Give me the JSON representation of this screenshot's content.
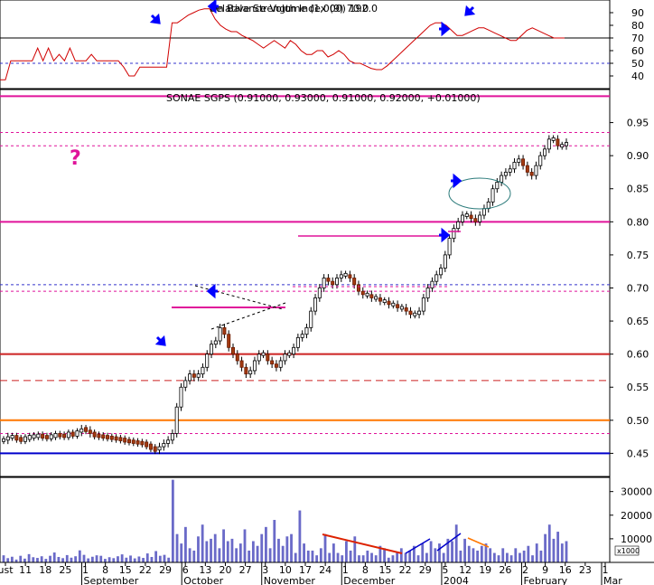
{
  "chart_data": [
    {
      "type": "line",
      "title": "Relative Strength Index (9) 70.0",
      "overlapping_label": "On Balance Volume (1,000) 192.0",
      "ylim": [
        30,
        100
      ],
      "yticks": [
        40,
        50,
        60,
        70,
        80,
        90
      ],
      "reference_lines": [
        70,
        50
      ],
      "series": [
        {
          "values": [
            37,
            37,
            52,
            52,
            52,
            52,
            52,
            62,
            52,
            62,
            52,
            57,
            52,
            62,
            52,
            52,
            52,
            57,
            52,
            52,
            52,
            52,
            52,
            47,
            40,
            40,
            47,
            47,
            47,
            47,
            47,
            47,
            82,
            82,
            85,
            88,
            90,
            92,
            93,
            93,
            85,
            80,
            77,
            75,
            75,
            72,
            70,
            68,
            65,
            62,
            65,
            68,
            65,
            62,
            68,
            65,
            60,
            57,
            57,
            60,
            60,
            55,
            57,
            60,
            57,
            52,
            50,
            50,
            48,
            46,
            45,
            45,
            48,
            52,
            56,
            60,
            64,
            68,
            72,
            76,
            80,
            82,
            82,
            80,
            76,
            72,
            72,
            74,
            76,
            78,
            78,
            76,
            74,
            72,
            70,
            68,
            68,
            72,
            76,
            78,
            76,
            74,
            72,
            70,
            70,
            70
          ]
        }
      ],
      "annotations": [
        "arrow",
        "arrow",
        "arrow",
        "arrow"
      ]
    },
    {
      "type": "candlestick",
      "title": "SONAE SGPS (0.91000, 0.93000, 0.91000, 0.92000, +0.01000)",
      "ylim": [
        0.415,
        1.0
      ],
      "yticks": [
        0.45,
        0.5,
        0.55,
        0.6,
        0.65,
        0.7,
        0.75,
        0.8,
        0.85,
        0.9,
        0.95
      ],
      "xtick_labels": [
        "ust",
        "11",
        "18",
        "25",
        "1",
        "8",
        "15",
        "22",
        "29",
        "6",
        "13",
        "20",
        "27",
        "3",
        "10",
        "17",
        "24",
        "1",
        "8",
        "15",
        "22",
        "29",
        "5",
        "12",
        "19",
        "26",
        "2",
        "9",
        "16",
        "23",
        "1"
      ],
      "month_labels": [
        "September",
        "October",
        "November",
        "December",
        "2004",
        "February",
        "Mar"
      ],
      "annotations": [
        "?"
      ],
      "horizontal_lines": [
        {
          "value": 0.99,
          "style": "solid",
          "color": "#e0139a"
        },
        {
          "value": 0.935,
          "style": "dashed",
          "color": "#e0139a"
        },
        {
          "value": 0.915,
          "style": "dashed",
          "color": "#e0139a"
        },
        {
          "value": 0.8,
          "style": "solid",
          "color": "#e0139a"
        },
        {
          "value": 0.705,
          "style": "dashed",
          "color": "#3333cc"
        },
        {
          "value": 0.695,
          "style": "dashed",
          "color": "#e0139a"
        },
        {
          "value": 0.6,
          "style": "solid",
          "color": "#cc2222"
        },
        {
          "value": 0.56,
          "style": "dashed",
          "color": "#cc2222"
        },
        {
          "value": 0.5,
          "style": "solid",
          "color": "#ff7700"
        },
        {
          "value": 0.48,
          "style": "dashed",
          "color": "#e0139a"
        },
        {
          "value": 0.45,
          "style": "solid",
          "color": "#0000cc"
        }
      ],
      "close": [
        0.47,
        0.475,
        0.475,
        0.472,
        0.47,
        0.473,
        0.475,
        0.476,
        0.477,
        0.475,
        0.474,
        0.476,
        0.478,
        0.477,
        0.476,
        0.48,
        0.478,
        0.482,
        0.487,
        0.485,
        0.48,
        0.477,
        0.476,
        0.475,
        0.474,
        0.473,
        0.472,
        0.471,
        0.469,
        0.468,
        0.467,
        0.466,
        0.465,
        0.462,
        0.458,
        0.455,
        0.46,
        0.465,
        0.47,
        0.48,
        0.52,
        0.55,
        0.56,
        0.57,
        0.565,
        0.57,
        0.58,
        0.6,
        0.615,
        0.62,
        0.64,
        0.63,
        0.61,
        0.6,
        0.59,
        0.58,
        0.57,
        0.575,
        0.59,
        0.6,
        0.6,
        0.59,
        0.585,
        0.58,
        0.59,
        0.6,
        0.6,
        0.61,
        0.625,
        0.63,
        0.64,
        0.665,
        0.685,
        0.7,
        0.715,
        0.71,
        0.705,
        0.715,
        0.72,
        0.72,
        0.715,
        0.705,
        0.695,
        0.69,
        0.69,
        0.685,
        0.685,
        0.68,
        0.68,
        0.675,
        0.675,
        0.67,
        0.67,
        0.665,
        0.66,
        0.66,
        0.665,
        0.685,
        0.7,
        0.71,
        0.72,
        0.73,
        0.75,
        0.775,
        0.79,
        0.8,
        0.81,
        0.81,
        0.805,
        0.8,
        0.81,
        0.82,
        0.83,
        0.85,
        0.86,
        0.87,
        0.875,
        0.88,
        0.89,
        0.895,
        0.885,
        0.875,
        0.87,
        0.885,
        0.9,
        0.91,
        0.925,
        0.925,
        0.915,
        0.915,
        0.92
      ]
    },
    {
      "type": "bar",
      "yticks": [
        10000,
        20000,
        30000
      ],
      "ylim": [
        0,
        36000
      ],
      "unit_label": "x1000",
      "values": [
        3000,
        1800,
        2400,
        1200,
        2800,
        1600,
        3500,
        2200,
        1900,
        2600,
        1500,
        2800,
        4200,
        2300,
        1800,
        3100,
        2000,
        2600,
        5100,
        3200,
        1700,
        2400,
        3000,
        2800,
        1500,
        2200,
        1800,
        2600,
        3400,
        2000,
        2900,
        1700,
        2500,
        1900,
        3800,
        2300,
        4800,
        2800,
        3200,
        2000,
        35000,
        12000,
        8000,
        15000,
        6000,
        5000,
        11000,
        16000,
        9000,
        10000,
        12000,
        6000,
        14000,
        9000,
        10000,
        6000,
        8000,
        14000,
        5000,
        9000,
        7000,
        12000,
        15000,
        6000,
        18000,
        10000,
        7000,
        11000,
        12000,
        4000,
        22000,
        8000,
        5000,
        5000,
        3000,
        6000,
        12000,
        4000,
        8000,
        4000,
        3000,
        9000,
        5000,
        11000,
        3000,
        3000,
        5000,
        4000,
        3000,
        7000,
        6000,
        2000,
        3000,
        4000,
        6000,
        4000,
        5000,
        7000,
        3000,
        8000,
        4000,
        9000,
        6000,
        8000,
        4000,
        10000,
        9000,
        16000,
        5000,
        10000,
        7000,
        6000,
        5000,
        7000,
        8000,
        6000,
        4000,
        3000,
        6000,
        4000,
        3000,
        6000,
        4000,
        5000,
        7000,
        3000,
        8000,
        5000,
        12000,
        16000,
        10000,
        13000,
        8000,
        9000
      ]
    }
  ]
}
